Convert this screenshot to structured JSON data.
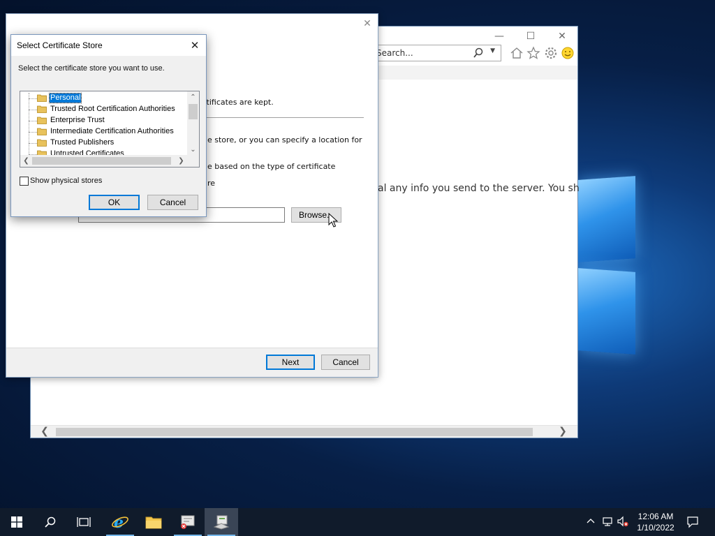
{
  "desktop": {},
  "ie_window": {
    "search_placeholder": "Search...",
    "content_text": "al any info you send to the server. You shou"
  },
  "wizard": {
    "lines": {
      "kept": "rtificates are kept.",
      "store_or_location": "e store, or you can specify a location for",
      "based_on_type": "e based on the type of certificate",
      "re": "re"
    },
    "browse_label": "Browse...",
    "next_label": "Next",
    "cancel_label": "Cancel"
  },
  "select_store_dialog": {
    "title": "Select Certificate Store",
    "prompt": "Select the certificate store you want to use.",
    "stores": [
      "Personal",
      "Trusted Root Certification Authorities",
      "Enterprise Trust",
      "Intermediate Certification Authorities",
      "Trusted Publishers",
      "Untrusted Certificates"
    ],
    "selected_index": 0,
    "show_physical_label": "Show physical stores",
    "show_physical_checked": false,
    "ok_label": "OK",
    "cancel_label": "Cancel"
  },
  "taskbar": {
    "time": "12:06 AM",
    "date": "1/10/2022"
  },
  "colors": {
    "accent": "#0078d7",
    "taskbar": "#101b2b",
    "folder": "#e8c25c"
  }
}
